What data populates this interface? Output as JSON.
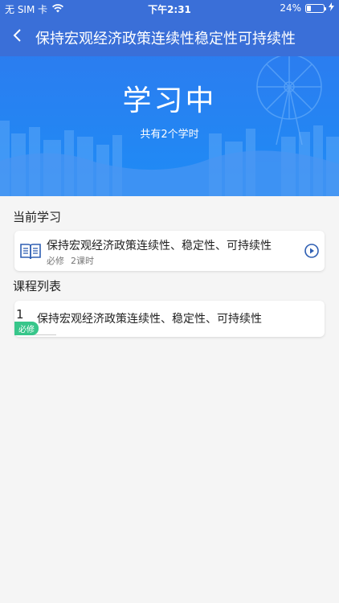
{
  "status_bar": {
    "carrier": "无 SIM 卡",
    "time": "下午2:31",
    "battery_percent": "24%",
    "battery_level": 0.24,
    "wifi_icon": "wifi-icon",
    "charging_icon": "bolt-icon"
  },
  "nav": {
    "back_icon": "chevron-left-icon",
    "title": "保持宏观经济政策连续性稳定性可持续性"
  },
  "hero": {
    "title": "学习中",
    "subtitle": "共有2个学时"
  },
  "current": {
    "heading": "当前学习",
    "icon": "open-book-icon",
    "title": "保持宏观经济政策连续性、稳定性、可持续性",
    "type": "必修",
    "hours": "2课时",
    "play_icon": "play-circle-icon"
  },
  "course_list": {
    "heading": "课程列表",
    "items": [
      {
        "index": "1",
        "title": "保持宏观经济政策连续性、稳定性、可持续性",
        "badge": "必修"
      }
    ]
  },
  "colors": {
    "primary": "#3a6fd8",
    "hero": "#1e8cf5",
    "badge": "#37c68a",
    "background": "#f5f5f5"
  }
}
